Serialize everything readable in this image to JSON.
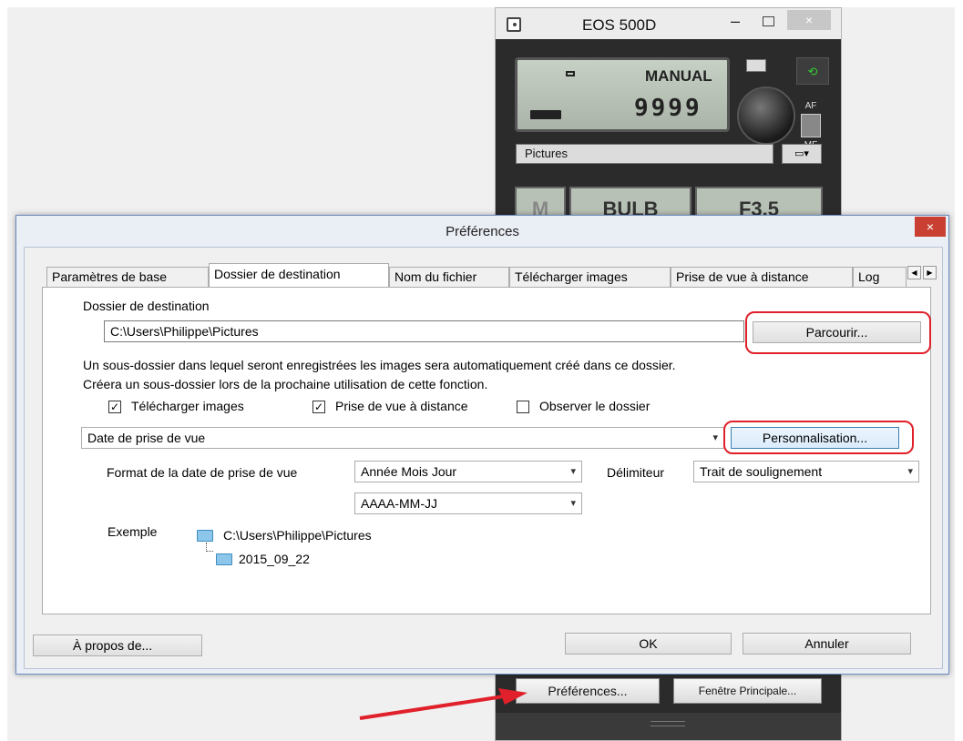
{
  "eos_window": {
    "title": "EOS 500D",
    "close_glyph": "×",
    "lcd": {
      "mode": "MANUAL",
      "shots": "9999"
    },
    "folder": "Pictures",
    "af_label": "AF",
    "mf_label": "MF",
    "modes": [
      "M",
      "BULB",
      "F3.5"
    ],
    "preferences_button": "Préférences...",
    "main_window_button": "Fenêtre Principale..."
  },
  "dialog": {
    "title": "Préférences",
    "close_glyph": "×",
    "tabs": [
      "Paramètres de base",
      "Dossier de destination",
      "Nom du fichier",
      "Télécharger images",
      "Prise de vue à distance",
      "Log"
    ],
    "active_tab": "Dossier de destination",
    "destination_label": "Dossier de destination",
    "destination_path": "C:\\Users\\Philippe\\Pictures",
    "browse_button": "Parcourir...",
    "info_line1": "Un sous-dossier dans lequel seront enregistrées les images sera automatiquement créé dans ce dossier.",
    "info_line2": "Créera un sous-dossier lors de la prochaine utilisation de cette fonction.",
    "checkboxes": [
      {
        "label": "Télécharger images",
        "checked": true
      },
      {
        "label": "Prise de vue à distance",
        "checked": true
      },
      {
        "label": "Observer le dossier",
        "checked": false
      }
    ],
    "subfolder_select": "Date de prise de vue",
    "customize_button": "Personnalisation...",
    "date_format_label": "Format de la date de prise de vue",
    "date_order_select": "Année Mois Jour",
    "date_pattern_select": "AAAA-MM-JJ",
    "delimiter_label": "Délimiteur",
    "delimiter_select": "Trait de soulignement",
    "example_label": "Exemple",
    "example_root": "C:\\Users\\Philippe\\Pictures",
    "example_sub": "2015_09_22",
    "about_button": "À propos de...",
    "ok_button": "OK",
    "cancel_button": "Annuler"
  },
  "colors": {
    "highlight": "#e0202a",
    "dialog_close": "#c94032",
    "arrow": "#e0202a"
  }
}
